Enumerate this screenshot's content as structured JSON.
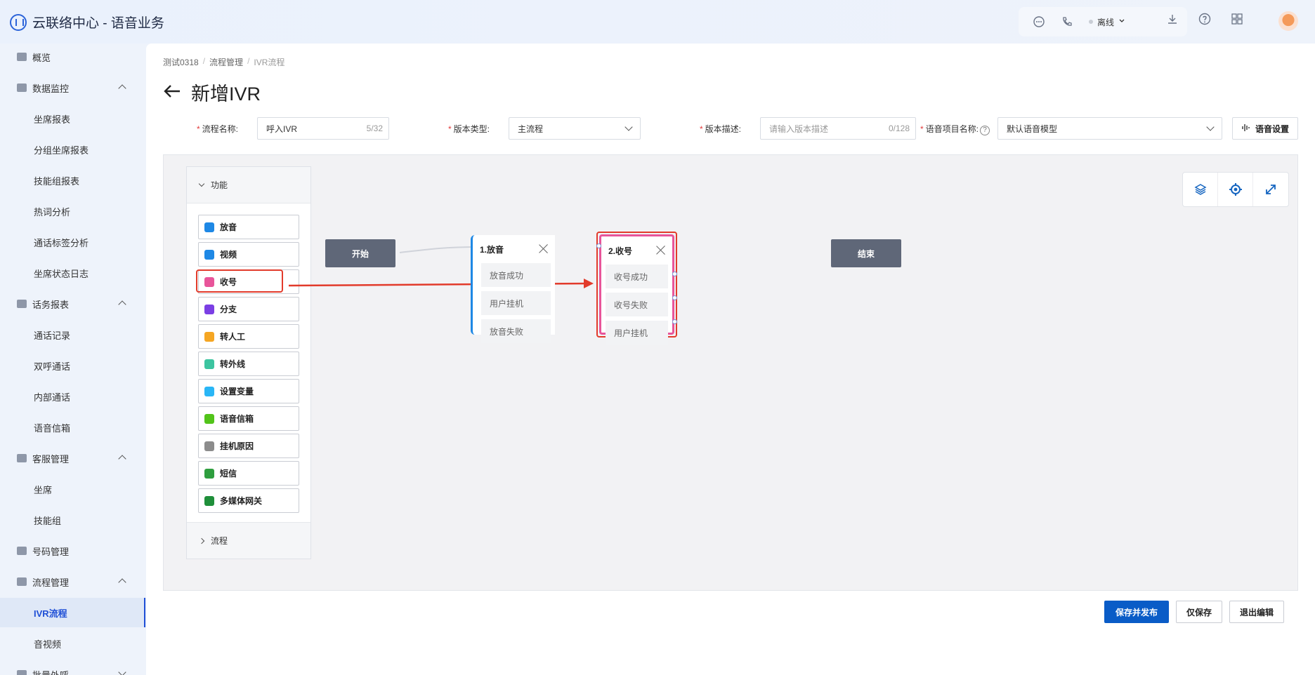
{
  "app": {
    "title": "云联络中心 - 语音业务"
  },
  "header": {
    "status": "离线"
  },
  "sidebar": {
    "items": [
      {
        "label": "概览",
        "type": "group",
        "expanded": null,
        "icon": "overview-icon"
      },
      {
        "label": "数据监控",
        "type": "group",
        "expanded": true,
        "icon": "monitor-icon"
      },
      {
        "label": "坐席报表",
        "type": "child"
      },
      {
        "label": "分组坐席报表",
        "type": "child"
      },
      {
        "label": "技能组报表",
        "type": "child"
      },
      {
        "label": "热词分析",
        "type": "child"
      },
      {
        "label": "通话标签分析",
        "type": "child"
      },
      {
        "label": "坐席状态日志",
        "type": "child"
      },
      {
        "label": "话务报表",
        "type": "group",
        "expanded": true,
        "icon": "report-icon"
      },
      {
        "label": "通话记录",
        "type": "child"
      },
      {
        "label": "双呼通话",
        "type": "child"
      },
      {
        "label": "内部通话",
        "type": "child"
      },
      {
        "label": "语音信箱",
        "type": "child"
      },
      {
        "label": "客服管理",
        "type": "group",
        "expanded": true,
        "icon": "headset-icon"
      },
      {
        "label": "坐席",
        "type": "child"
      },
      {
        "label": "技能组",
        "type": "child"
      },
      {
        "label": "号码管理",
        "type": "group",
        "expanded": null,
        "icon": "phone-icon"
      },
      {
        "label": "流程管理",
        "type": "group",
        "expanded": true,
        "icon": "flow-icon"
      },
      {
        "label": "IVR流程",
        "type": "child",
        "active": true
      },
      {
        "label": "音视频",
        "type": "child"
      },
      {
        "label": "批量外呼",
        "type": "group",
        "expanded": false,
        "icon": "batch-icon"
      }
    ]
  },
  "breadcrumb": [
    "测试0318",
    "流程管理",
    "IVR流程"
  ],
  "page": {
    "title": "新增IVR"
  },
  "form": {
    "flow_name_label": "流程名称:",
    "flow_name_value": "呼入IVR",
    "flow_name_count": "5/32",
    "version_type_label": "版本类型:",
    "version_type_value": "主流程",
    "version_desc_label": "版本描述:",
    "version_desc_placeholder": "请输入版本描述",
    "version_desc_count": "0/128",
    "voice_project_label": "语音项目名称:",
    "voice_project_value": "默认语音模型",
    "voice_settings_button": "语音设置"
  },
  "palette": {
    "section_function": "功能",
    "section_flow": "流程",
    "items": [
      {
        "label": "放音",
        "color": "#1e88e5"
      },
      {
        "label": "视频",
        "color": "#1e88e5"
      },
      {
        "label": "收号",
        "color": "#e8559a"
      },
      {
        "label": "分支",
        "color": "#7b3fe4"
      },
      {
        "label": "转人工",
        "color": "#f5a623"
      },
      {
        "label": "转外线",
        "color": "#3cc4a0"
      },
      {
        "label": "设置变量",
        "color": "#29b6f6"
      },
      {
        "label": "语音信箱",
        "color": "#52c41a"
      },
      {
        "label": "挂机原因",
        "color": "#8c8c8c"
      },
      {
        "label": "短信",
        "color": "#2e9e3e"
      },
      {
        "label": "多媒体网关",
        "color": "#1f8f3a"
      }
    ]
  },
  "canvas": {
    "start_label": "开始",
    "end_label": "结束",
    "nodes": [
      {
        "title": "1.放音",
        "options": [
          "放音成功",
          "用户挂机",
          "放音失败"
        ],
        "accent": "#1e88e5"
      },
      {
        "title": "2.收号",
        "options": [
          "收号成功",
          "收号失败",
          "用户挂机"
        ],
        "accent": "#e8559a"
      }
    ],
    "annotation_color": "#e23b2b"
  },
  "actions": {
    "save_publish": "保存并发布",
    "save_only": "仅保存",
    "exit_edit": "退出编辑"
  }
}
